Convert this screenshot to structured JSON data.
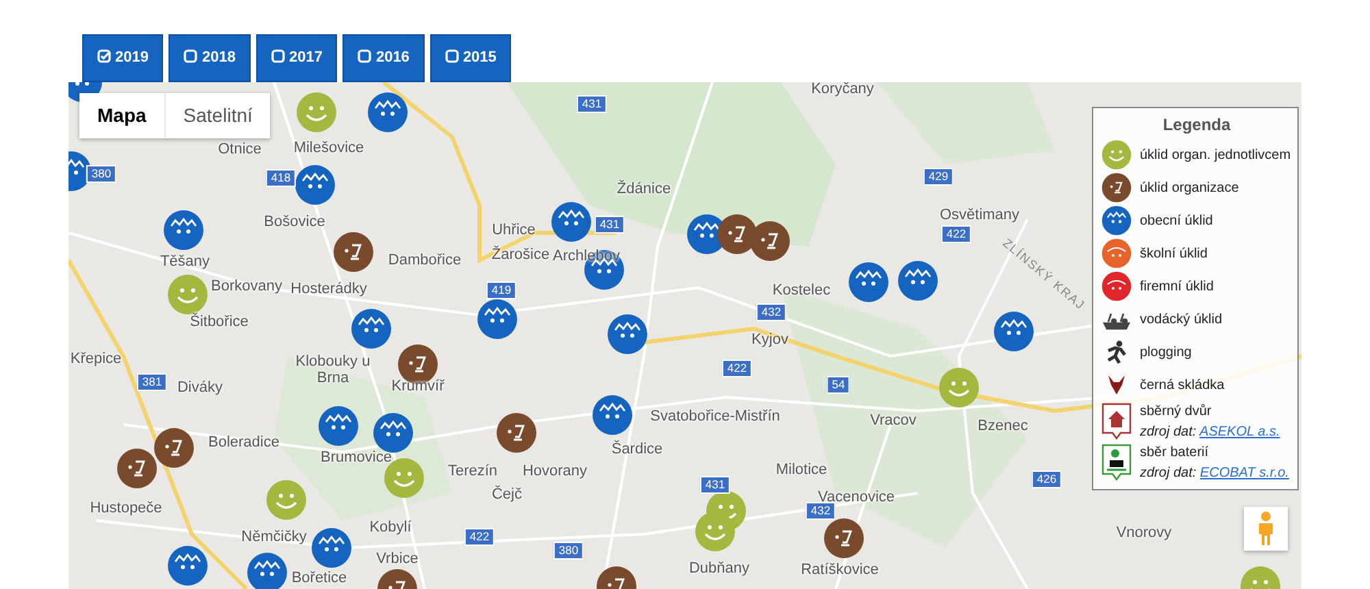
{
  "year_buttons": [
    {
      "label": "2019",
      "checked": true
    },
    {
      "label": "2018",
      "checked": false
    },
    {
      "label": "2017",
      "checked": false
    },
    {
      "label": "2016",
      "checked": false
    },
    {
      "label": "2015",
      "checked": false
    }
  ],
  "map": {
    "type_tabs": [
      {
        "label": "Mapa",
        "selected": true
      },
      {
        "label": "Satelitní",
        "selected": false
      }
    ],
    "places": [
      "Koryčany",
      "Otnice",
      "Milešovice",
      "Ždánice",
      "Bošovice",
      "Uhřice",
      "Dambořice",
      "Žarošice",
      "Archlebov",
      "Těšany",
      "Borkovany",
      "Hosterádky",
      "Šitbořice",
      "Kostelec",
      "Kyjov",
      "Osvětimany",
      "Křepice",
      "Diváky",
      "Klobouky u Brna",
      "Krumvíř",
      "Boleradice",
      "Brumovice",
      "Svatobořice-Mistřín",
      "Vracov",
      "Bzenec",
      "Šardice",
      "Terezín",
      "Hovorany",
      "Hustopeče",
      "Čejč",
      "Němčičky",
      "Milotice",
      "Vacenovice",
      "Kobylí",
      "Vnorovy",
      "Vrbice",
      "Bořetice",
      "Dubňany",
      "Ratíškovice"
    ],
    "regions": [
      "ZLÍNSKÝ KRAJ"
    ],
    "roads": [
      "431",
      "380",
      "418",
      "431",
      "419",
      "432",
      "422",
      "54",
      "381",
      "431",
      "432",
      "422",
      "380",
      "426",
      "429",
      "422"
    ],
    "markers": [
      {
        "kind": "municipal"
      },
      {
        "kind": "individual"
      },
      {
        "kind": "municipal"
      },
      {
        "kind": "municipal"
      },
      {
        "kind": "municipal"
      },
      {
        "kind": "municipal"
      },
      {
        "kind": "organization"
      },
      {
        "kind": "individual"
      },
      {
        "kind": "municipal"
      },
      {
        "kind": "municipal"
      },
      {
        "kind": "municipal"
      },
      {
        "kind": "organization"
      },
      {
        "kind": "organization"
      },
      {
        "kind": "municipal"
      },
      {
        "kind": "municipal"
      },
      {
        "kind": "municipal"
      },
      {
        "kind": "municipal"
      },
      {
        "kind": "organization"
      },
      {
        "kind": "municipal"
      },
      {
        "kind": "municipal"
      },
      {
        "kind": "individual"
      },
      {
        "kind": "municipal"
      },
      {
        "kind": "municipal"
      },
      {
        "kind": "organization"
      },
      {
        "kind": "organization"
      },
      {
        "kind": "organization"
      },
      {
        "kind": "municipal"
      },
      {
        "kind": "individual"
      },
      {
        "kind": "individual"
      },
      {
        "kind": "municipal"
      },
      {
        "kind": "municipal"
      },
      {
        "kind": "municipal"
      },
      {
        "kind": "organization"
      },
      {
        "kind": "organization"
      },
      {
        "kind": "individual"
      },
      {
        "kind": "individual"
      },
      {
        "kind": "organization"
      },
      {
        "kind": "individual"
      }
    ],
    "legend": {
      "title": "Legenda",
      "items": [
        {
          "kind": "individual",
          "label": "úklid organ. jednotlivcem"
        },
        {
          "kind": "organization",
          "label": "úklid organizace"
        },
        {
          "kind": "municipal",
          "label": "obecní úklid"
        },
        {
          "kind": "school",
          "label": "školní úklid"
        },
        {
          "kind": "company",
          "label": "firemní úklid"
        },
        {
          "kind": "boat",
          "label": "vodácký úklid"
        },
        {
          "kind": "plogging",
          "label": "plogging"
        },
        {
          "kind": "dump",
          "label": "černá skládka"
        },
        {
          "kind": "yard",
          "label": "sběrný dvůr",
          "source_label": "zdroj dat:",
          "source_link": "ASEKOL a.s."
        },
        {
          "kind": "battery",
          "label": "sběr baterií",
          "source_label": "zdroj dat:",
          "source_link": "ECOBAT s.r.o."
        }
      ]
    }
  }
}
